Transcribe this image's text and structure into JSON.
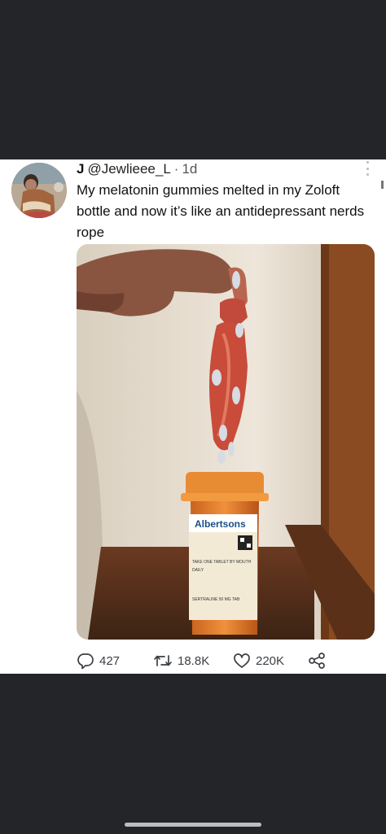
{
  "tweet": {
    "display_name": "J",
    "handle": "@Jewlieee_L",
    "separator": "·",
    "age": "1d",
    "text": "My melatonin gummies melted in my Zoloft bottle and now it’s like an antidepressant nerds rope"
  },
  "photo": {
    "label_brand": "Albertsons",
    "label_lines": [
      "TAKE ONE TABLET BY MOUTH",
      "DAILY",
      "SERTRALINE 50 MG TAB"
    ]
  },
  "actions": {
    "replies": "427",
    "retweets": "18.8K",
    "likes": "220K"
  },
  "icons": {
    "reply": "reply-icon",
    "retweet": "retweet-icon",
    "like": "heart-icon",
    "share": "share-icon",
    "more": "more-icon"
  },
  "colors": {
    "background": "#242529",
    "card": "#ffffff",
    "text": "#111111",
    "icon": "#3b3f44"
  }
}
